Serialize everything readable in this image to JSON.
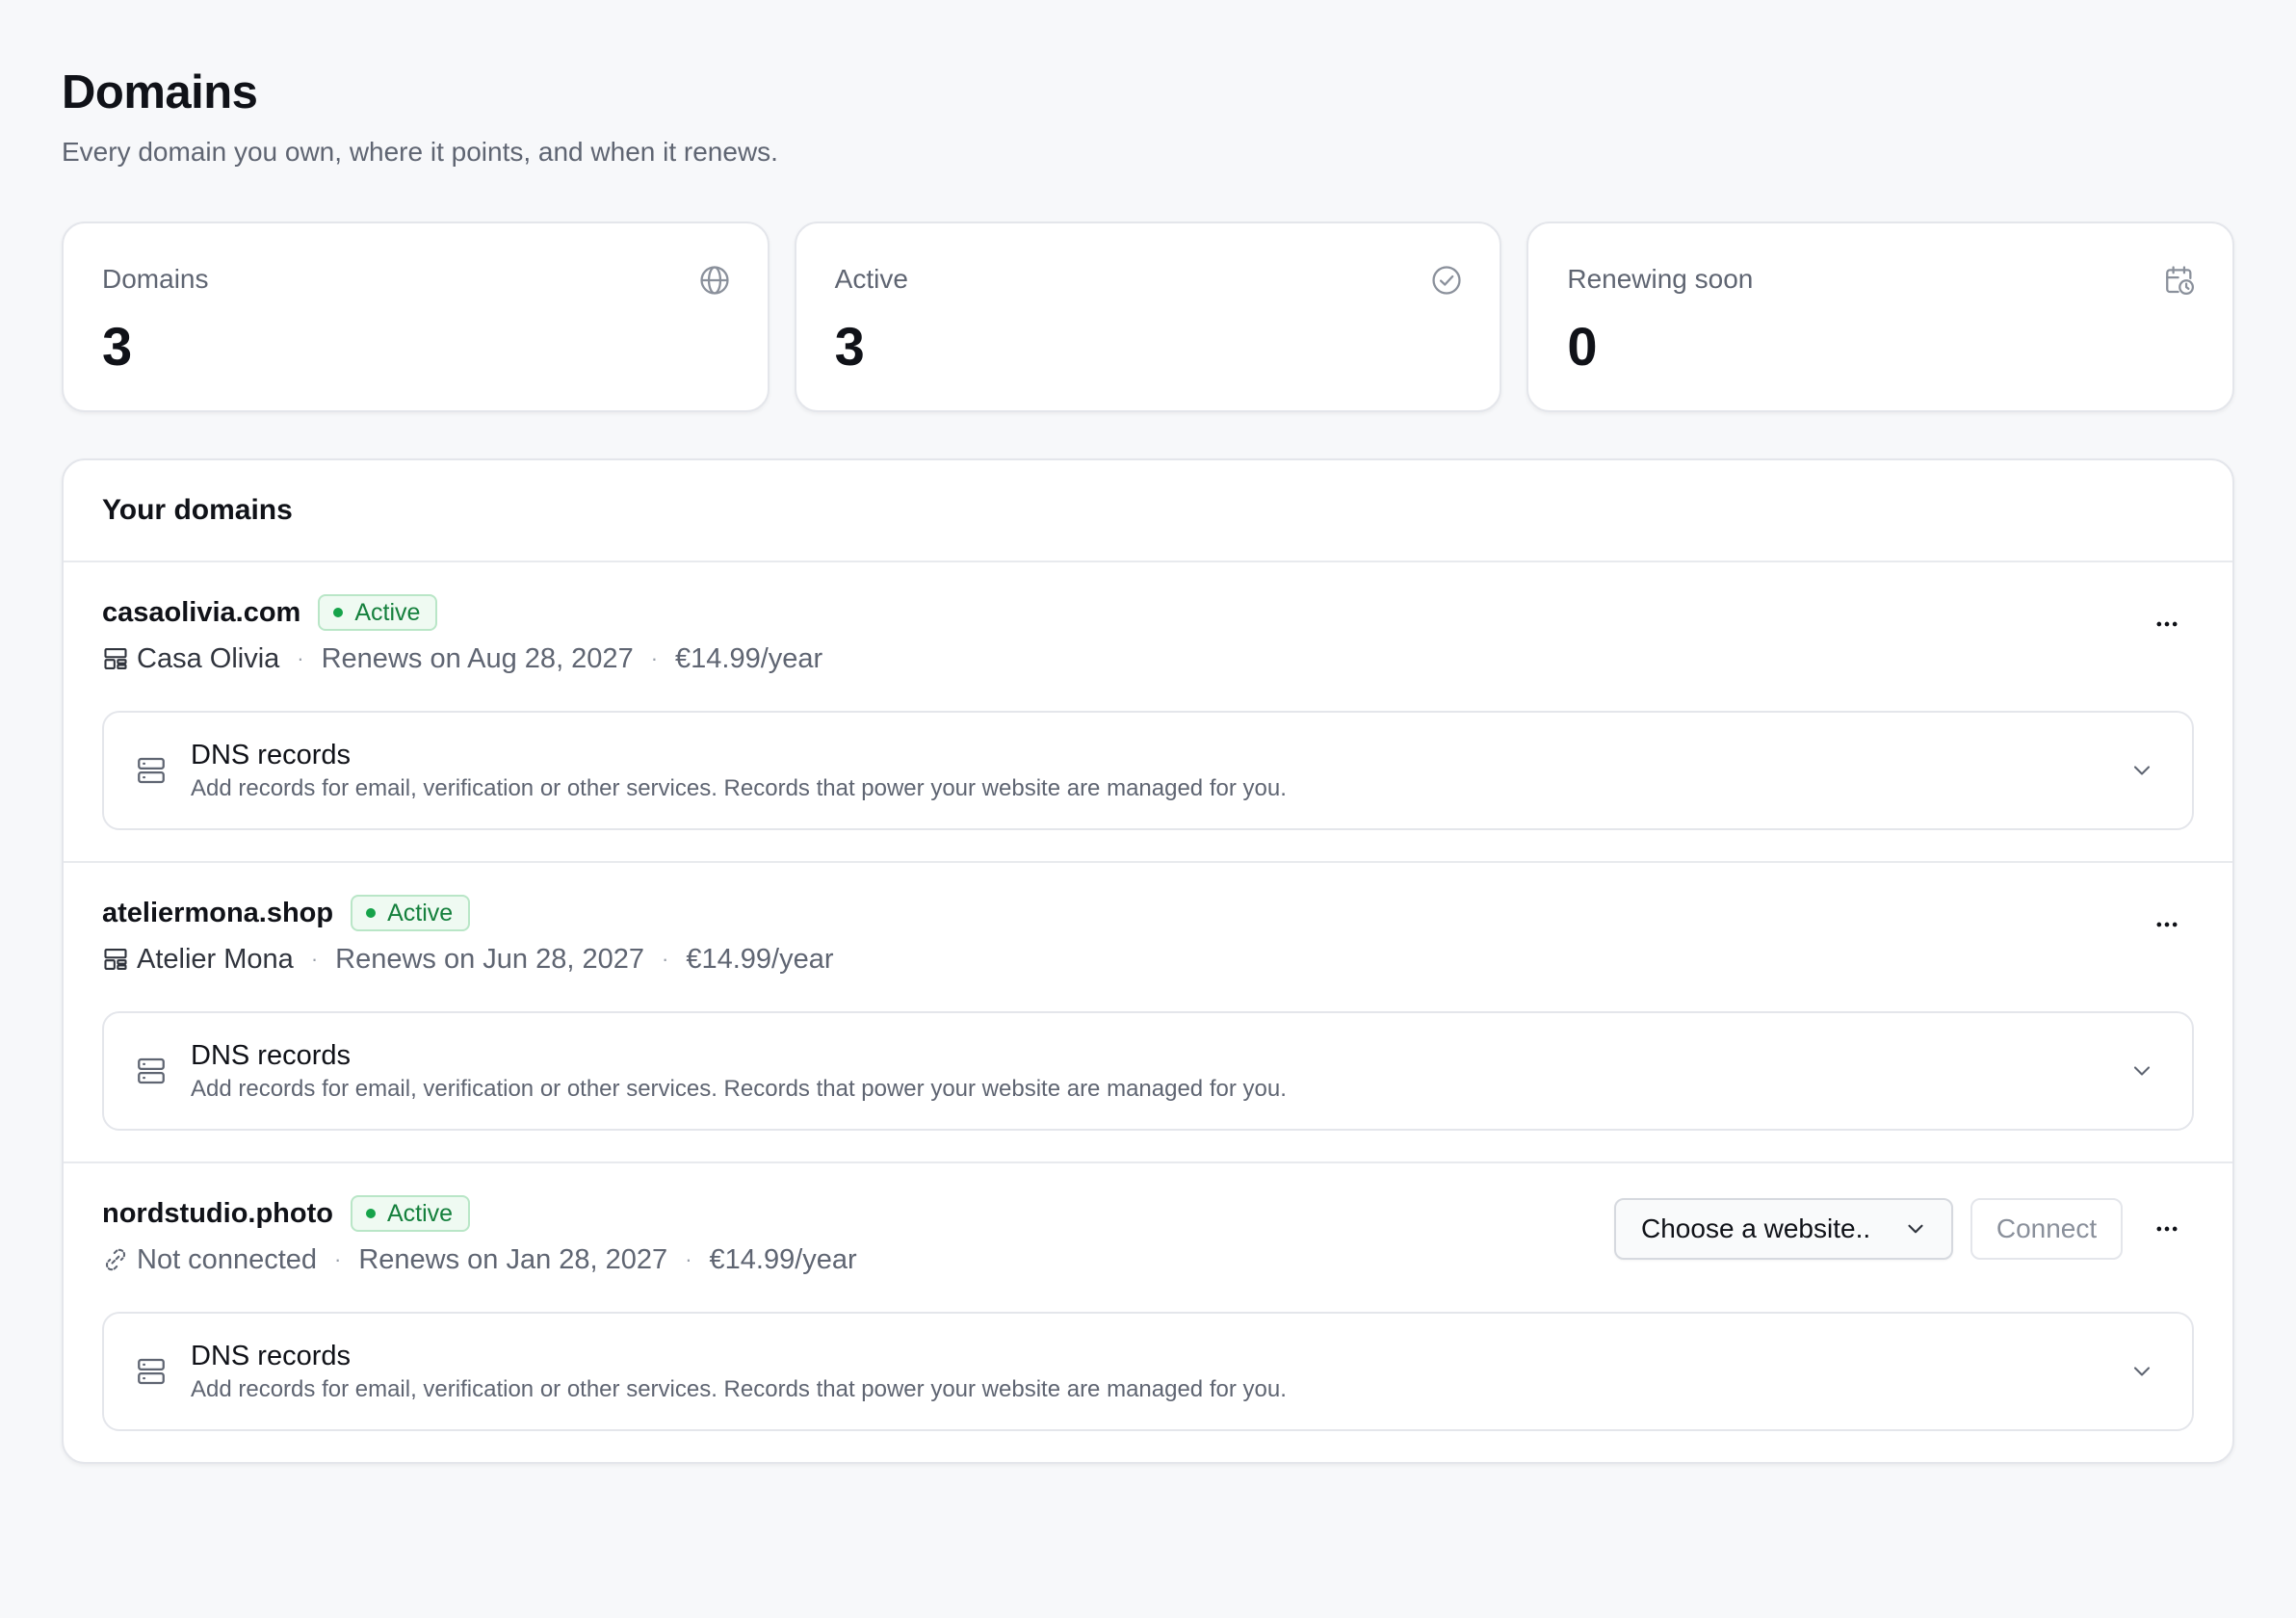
{
  "page": {
    "title": "Domains",
    "subtitle": "Every domain you own, where it points, and when it renews."
  },
  "stats": [
    {
      "label": "Domains",
      "value": "3",
      "icon": "globe-icon"
    },
    {
      "label": "Active",
      "value": "3",
      "icon": "check-circle-icon"
    },
    {
      "label": "Renewing soon",
      "value": "0",
      "icon": "calendar-clock-icon"
    }
  ],
  "domains_card": {
    "title": "Your domains"
  },
  "domains": [
    {
      "name": "casaolivia.com",
      "status": "Active",
      "site": "Casa Olivia",
      "site_icon": "layout-icon",
      "renews": "Renews on Aug 28, 2027",
      "price": "€14.99/year",
      "dns_title": "DNS records",
      "dns_desc": "Add records for email, verification or other services. Records that power your website are managed for you."
    },
    {
      "name": "ateliermona.shop",
      "status": "Active",
      "site": "Atelier Mona",
      "site_icon": "layout-icon",
      "renews": "Renews on Jun 28, 2027",
      "price": "€14.99/year",
      "dns_title": "DNS records",
      "dns_desc": "Add records for email, verification or other services. Records that power your website are managed for you."
    },
    {
      "name": "nordstudio.photo",
      "status": "Active",
      "site": "Not connected",
      "site_icon": "unlink-icon",
      "renews": "Renews on Jan 28, 2027",
      "price": "€14.99/year",
      "select_label": "Choose a website..",
      "connect_label": "Connect",
      "dns_title": "DNS records",
      "dns_desc": "Add records for email, verification or other services. Records that power your website are managed for you."
    }
  ],
  "colors": {
    "background": "#f7f8fa",
    "active_green": "#15803d",
    "badge_bg": "#effaf2",
    "muted_text": "#5f6572"
  }
}
